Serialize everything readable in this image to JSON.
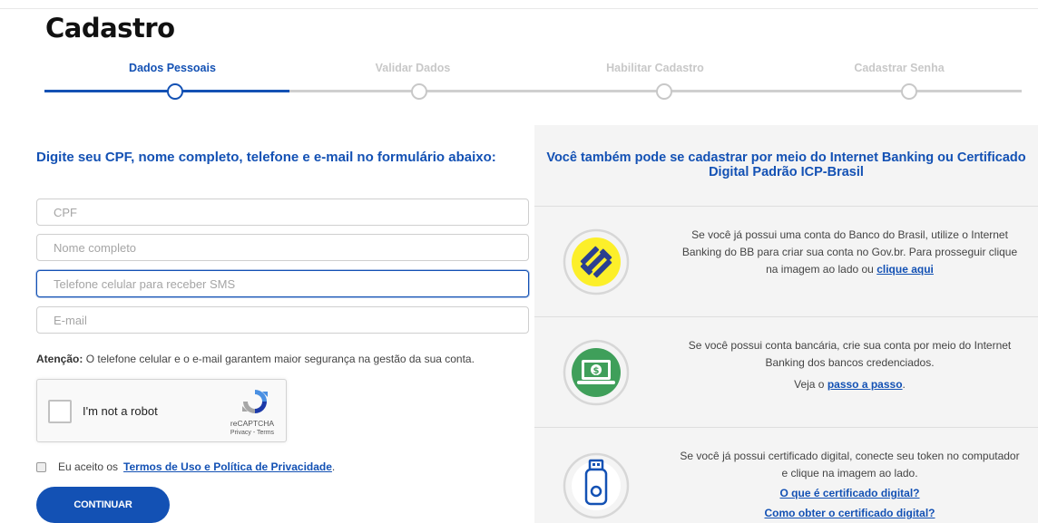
{
  "page": {
    "title": "Cadastro"
  },
  "stepper": {
    "steps": [
      {
        "label": "Dados Pessoais"
      },
      {
        "label": "Validar Dados"
      },
      {
        "label": "Habilitar Cadastro"
      },
      {
        "label": "Cadastrar Senha"
      }
    ],
    "active_step": 1,
    "active_color": "#1351b4",
    "inactive_color": "#c8c8c8"
  },
  "form": {
    "heading": "Digite seu CPF, nome completo, telefone e e-mail no formulário abaixo:",
    "cpf_placeholder": "CPF",
    "name_placeholder": "Nome completo",
    "phone_placeholder": "Telefone celular para receber SMS",
    "email_placeholder": "E-mail",
    "attention_label": "Atenção:",
    "attention_text": "O telefone celular e o e-mail garantem maior segurança na gestão da sua conta.",
    "captcha": {
      "label": "I'm not a robot",
      "brand": "reCAPTCHA",
      "privacy": "Privacy",
      "sep": "-",
      "terms": "Terms"
    },
    "accept_prefix": "Eu aceito os",
    "accept_link": "Termos de Uso e Política de Privacidade",
    "accept_suffix": ".",
    "continue_label": "CONTINUAR"
  },
  "alternatives": {
    "heading": "Você também pode se cadastrar por meio do Internet Banking ou Certificado Digital Padrão ICP-Brasil",
    "bb": {
      "icon": "banco-do-brasil-icon",
      "text": "Se você já possui uma conta do Banco do Brasil, utilize o Internet Banking do BB para criar sua conta no Gov.br. Para prosseguir clique na imagem ao lado ou",
      "link": "clique aqui"
    },
    "banks": {
      "icon": "internet-banking-icon",
      "text": "Se você possui conta bancária, crie sua conta por meio do Internet Banking dos bancos credenciados.",
      "see_prefix": "Veja o",
      "link": "passo a passo",
      "see_suffix": "."
    },
    "cert": {
      "icon": "usb-token-icon",
      "text": "Se você já possui certificado digital, conecte seu token no computador e clique na imagem ao lado.",
      "link1": "O que é certificado digital?",
      "link2": "Como obter o certificado digital?"
    }
  },
  "colors": {
    "primary": "#1351b4",
    "bb_yellow": "#fcef2a",
    "money_green": "#3f9f5a",
    "panel_bg": "#f4f4f4"
  }
}
